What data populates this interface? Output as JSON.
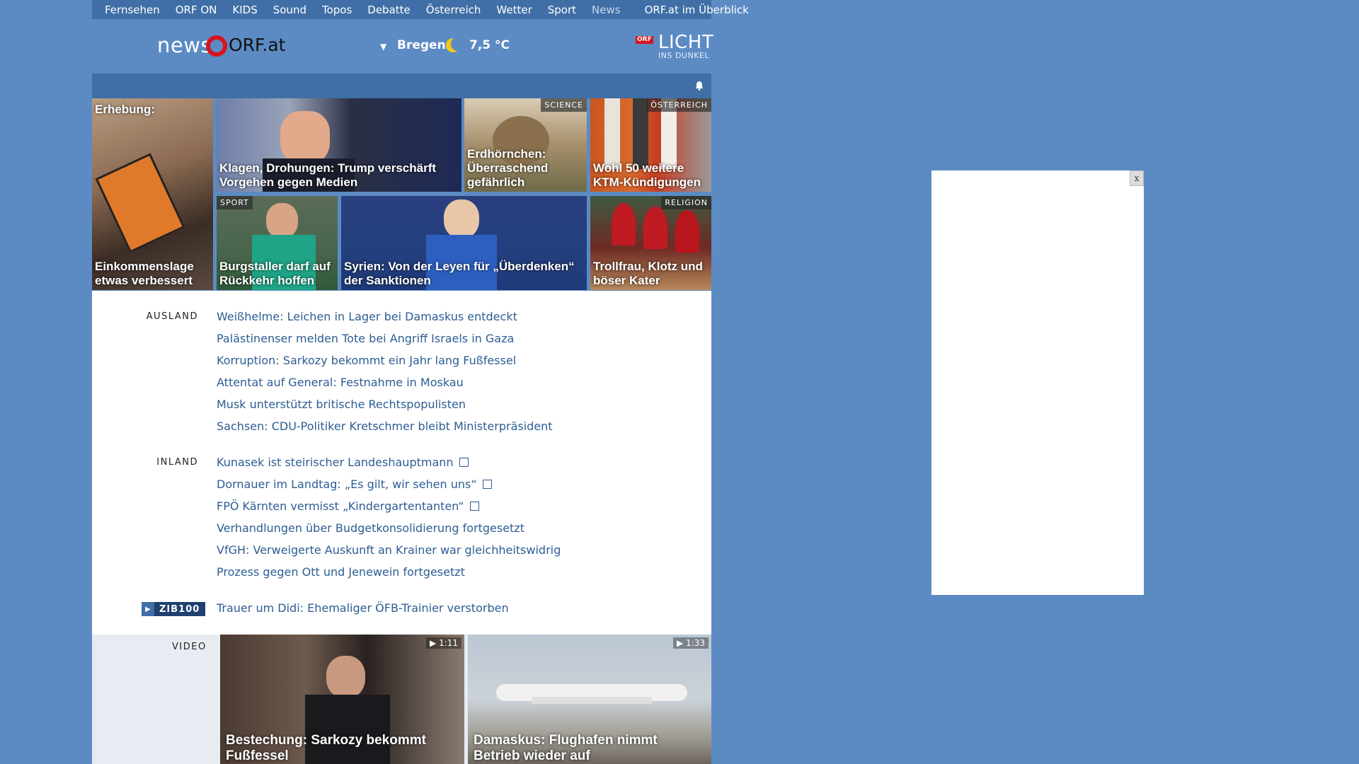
{
  "nav": {
    "items": [
      "Fernsehen",
      "ORF ON",
      "KIDS",
      "Sound",
      "Topos",
      "Debatte",
      "Österreich",
      "Wetter",
      "Sport",
      "News"
    ],
    "overview": "ORF.at im Überblick"
  },
  "header": {
    "logo_news": "news",
    "logo_orf": "ORF.at",
    "location": "Bregenz",
    "temperature": "7,5 °C",
    "licht_badge": "ORF",
    "licht_title": "LICHT",
    "licht_sub": "INS DUNKEL"
  },
  "tiles": [
    {
      "top": "Erhebung:",
      "caption": "Einkommenslage etwas verbessert"
    },
    {
      "caption": "Klagen, Drohungen: Trump verschärft Vorgehen gegen Medien"
    },
    {
      "tag": "SCIENCE",
      "caption": "Erdhörnchen: Überraschend gefährlich"
    },
    {
      "tag": "ÖSTERREICH",
      "caption": "Wohl 50 weitere KTM-Kündigungen"
    },
    {
      "tag": "SPORT",
      "caption": "Burgstaller darf auf Rückkehr hoffen"
    },
    {
      "caption": "Syrien: Von der Leyen für „Überdenken“ der Sanktionen"
    },
    {
      "tag": "RELIGION",
      "caption": "Trollfrau, Klotz und böser Kater"
    }
  ],
  "sections": {
    "ausland": {
      "label": "AUSLAND",
      "items": [
        "Weißhelme: Leichen in Lager bei Damaskus entdeckt",
        "Palästinenser melden Tote bei Angriff Israels in Gaza",
        "Korruption: Sarkozy bekommt ein Jahr lang Fußfessel",
        "Attentat auf General: Festnahme in Moskau",
        "Musk unterstützt britische Rechtspopulisten",
        "Sachsen: CDU-Politiker Kretschmer bleibt Ministerpräsident"
      ]
    },
    "inland": {
      "label": "INLAND",
      "items": [
        "Kunasek ist steirischer Landeshauptmann",
        "Dornauer im Landtag: „Es gilt, wir sehen uns“",
        "FPÖ Kärnten vermisst „Kindergartentanten“",
        "Verhandlungen über Budgetkonsolidierung fortgesetzt",
        "VfGH: Verweigerte Auskunft an Krainer war gleichheitswidrig",
        "Prozess gegen Ott und Jenewein fortgesetzt"
      ]
    },
    "zib": {
      "badge": "ZIB100",
      "item": "Trauer um Didi: Ehemaliger ÖFB-Trainier verstorben"
    }
  },
  "video": {
    "label": "VIDEO",
    "items": [
      {
        "duration": "▶ 1:11",
        "caption": "Bestechung: Sarkozy bekommt Fußfessel"
      },
      {
        "duration": "▶ 1:33",
        "caption": "Damaskus: Flughafen nimmt Betrieb wieder auf"
      }
    ]
  },
  "ad": {
    "close": "x"
  },
  "colors": {
    "background": "#5c8bc4",
    "nav": "#3f6fa6",
    "link": "#2d5d93",
    "brand_red": "#d8141e"
  }
}
